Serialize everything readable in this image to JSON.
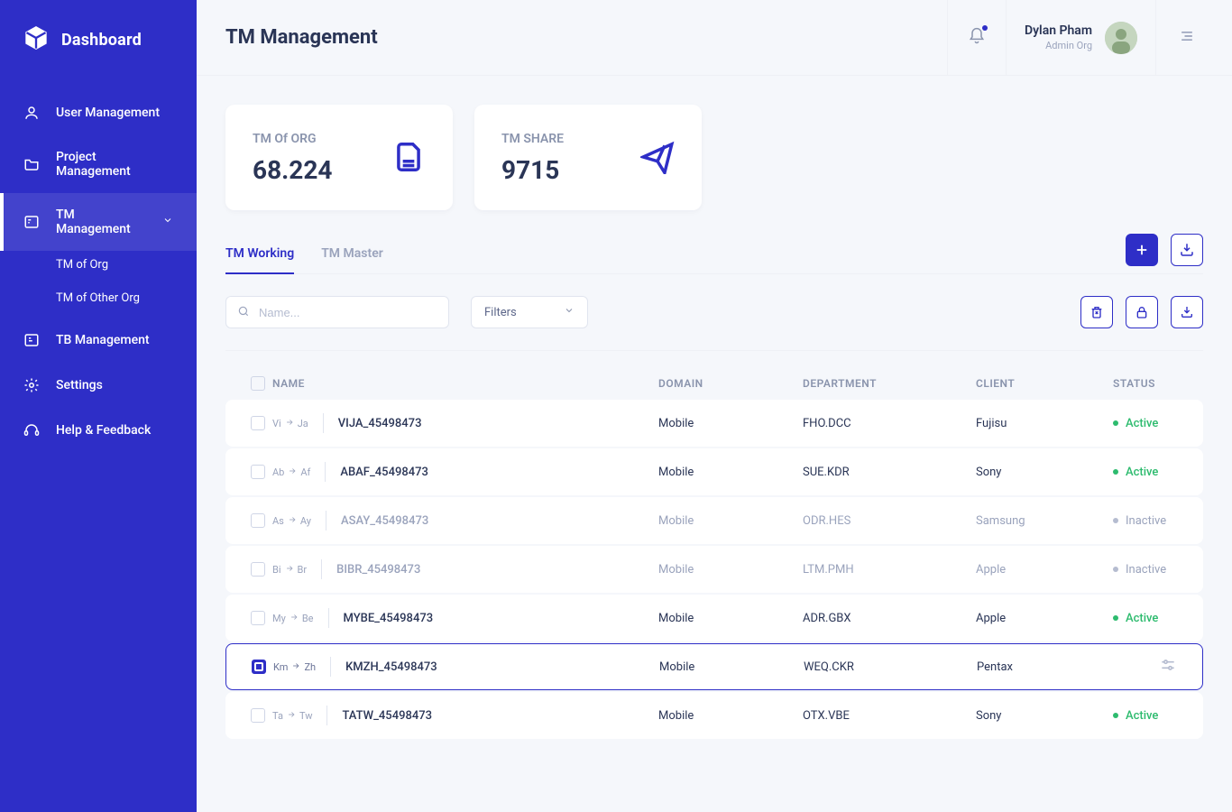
{
  "brand": "Dashboard",
  "sidebar": {
    "items": [
      {
        "label": "User Management"
      },
      {
        "label": "Project Management"
      },
      {
        "label": "TM Management"
      },
      {
        "label": "TB Management"
      },
      {
        "label": "Settings"
      },
      {
        "label": "Help & Feedback"
      }
    ],
    "submenus": {
      "tm": [
        {
          "label": "TM of Org"
        },
        {
          "label": "TM of Other Org"
        }
      ]
    }
  },
  "header": {
    "page_title": "TM Management",
    "user": {
      "name": "Dylan Pham",
      "role": "Admin Org"
    }
  },
  "stats": [
    {
      "label": "TM Of ORG",
      "value": "68.224"
    },
    {
      "label": "TM SHARE",
      "value": "9715"
    }
  ],
  "tabs": [
    {
      "label": "TM Working",
      "active": true
    },
    {
      "label": "TM Master",
      "active": false
    }
  ],
  "filters": {
    "search_placeholder": "Name...",
    "filters_label": "Filters"
  },
  "table": {
    "columns": {
      "name": "NAME",
      "domain": "DOMAIN",
      "department": "DEPARTMENT",
      "client": "CLIENT",
      "status": "STATUS"
    },
    "status_labels": {
      "active": "Active",
      "inactive": "Inactive"
    },
    "rows": [
      {
        "lang_from": "Vi",
        "lang_to": "Ja",
        "name": "VIJA_45498473",
        "domain": "Mobile",
        "dept": "FHO.DCC",
        "client": "Fujisu",
        "status": "active",
        "checked": false
      },
      {
        "lang_from": "Ab",
        "lang_to": "Af",
        "name": "ABAF_45498473",
        "domain": "Mobile",
        "dept": "SUE.KDR",
        "client": "Sony",
        "status": "active",
        "checked": false
      },
      {
        "lang_from": "As",
        "lang_to": "Ay",
        "name": "ASAY_45498473",
        "domain": "Mobile",
        "dept": "ODR.HES",
        "client": "Samsung",
        "status": "inactive",
        "checked": false
      },
      {
        "lang_from": "Bi",
        "lang_to": "Br",
        "name": "BIBR_45498473",
        "domain": "Mobile",
        "dept": "LTM.PMH",
        "client": "Apple",
        "status": "inactive",
        "checked": false
      },
      {
        "lang_from": "My",
        "lang_to": "Be",
        "name": "MYBE_45498473",
        "domain": "Mobile",
        "dept": "ADR.GBX",
        "client": "Apple",
        "status": "active",
        "checked": false
      },
      {
        "lang_from": "Km",
        "lang_to": "Zh",
        "name": "KMZH_45498473",
        "domain": "Mobile",
        "dept": "WEQ.CKR",
        "client": "Pentax",
        "status": "selected",
        "checked": true
      },
      {
        "lang_from": "Ta",
        "lang_to": "Tw",
        "name": "TATW_45498473",
        "domain": "Mobile",
        "dept": "OTX.VBE",
        "client": "Sony",
        "status": "active",
        "checked": false
      }
    ]
  }
}
